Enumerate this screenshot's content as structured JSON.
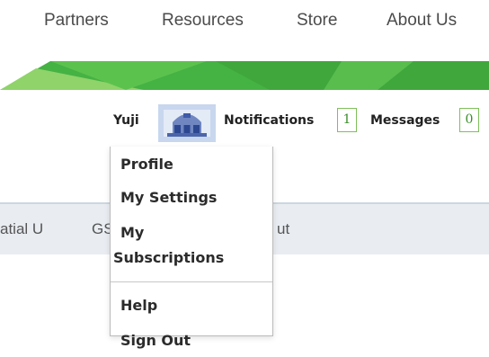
{
  "top_nav": {
    "items": [
      "Partners",
      "Resources",
      "Store",
      "About Us"
    ]
  },
  "user_bar": {
    "username": "Yuji",
    "avatar_icon": "castle-avatar-icon",
    "notifications_label": "Notifications",
    "notifications_count": "1",
    "messages_label": "Messages",
    "messages_count": "0"
  },
  "sub_nav": {
    "items": [
      "atial U",
      "GS",
      "ut"
    ]
  },
  "user_menu": {
    "items": [
      "Profile",
      "My Settings",
      "My",
      "Subscriptions",
      "Help",
      "Sign Out"
    ]
  },
  "colors": {
    "banner_green": "#4cb848",
    "count_border": "#7fbf5a",
    "subnav_bg": "#e9edf2"
  }
}
